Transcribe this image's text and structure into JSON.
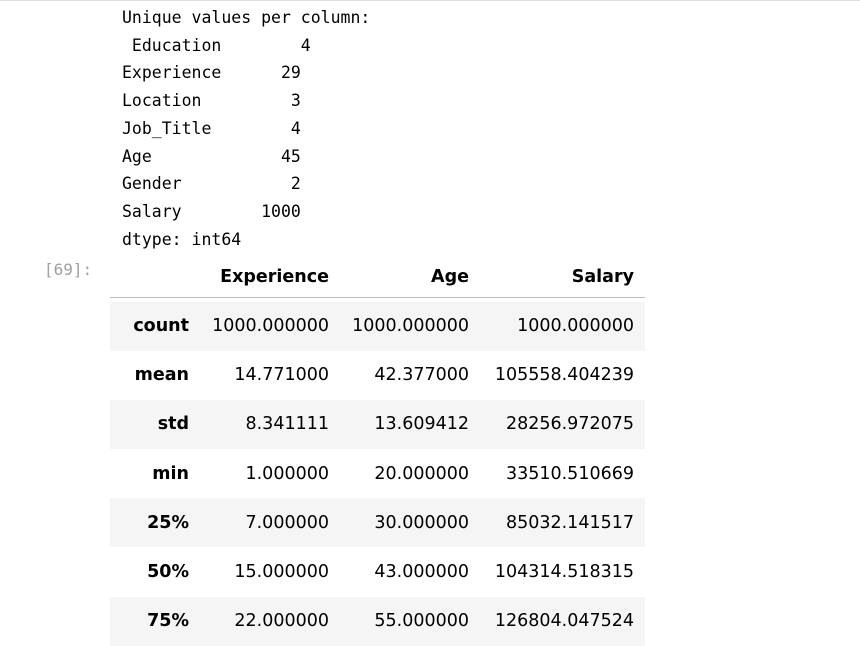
{
  "stream_output": {
    "lines": [
      "Unique values per column:",
      " Education        4",
      "Experience      29",
      "Location         3",
      "Job_Title        4",
      "Age             45",
      "Gender           2",
      "Salary        1000",
      "dtype: int64"
    ]
  },
  "cell": {
    "prompt": "[69]:"
  },
  "describe_table": {
    "columns": [
      "Experience",
      "Age",
      "Salary"
    ],
    "rows": [
      {
        "label": "count",
        "values": [
          "1000.000000",
          "1000.000000",
          "1000.000000"
        ]
      },
      {
        "label": "mean",
        "values": [
          "14.771000",
          "42.377000",
          "105558.404239"
        ]
      },
      {
        "label": "std",
        "values": [
          "8.341111",
          "13.609412",
          "28256.972075"
        ]
      },
      {
        "label": "min",
        "values": [
          "1.000000",
          "20.000000",
          "33510.510669"
        ]
      },
      {
        "label": "25%",
        "values": [
          "7.000000",
          "30.000000",
          "85032.141517"
        ]
      },
      {
        "label": "50%",
        "values": [
          "15.000000",
          "43.000000",
          "104314.518315"
        ]
      },
      {
        "label": "75%",
        "values": [
          "22.000000",
          "55.000000",
          "126804.047524"
        ]
      }
    ]
  }
}
